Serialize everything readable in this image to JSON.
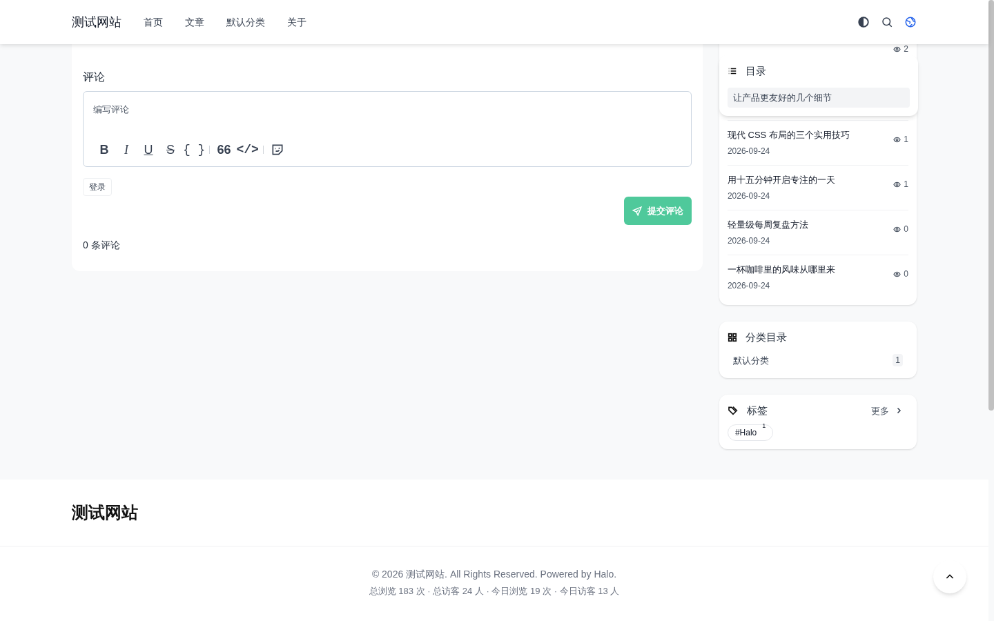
{
  "header": {
    "site_title": "测试网站",
    "nav": [
      {
        "label": "首页"
      },
      {
        "label": "文章"
      },
      {
        "label": "默认分类"
      },
      {
        "label": "关于"
      }
    ]
  },
  "comments": {
    "title": "评论",
    "placeholder": "编写评论",
    "toolbar": [
      {
        "kind": "bold",
        "label": "B"
      },
      {
        "kind": "italic",
        "label": "I"
      },
      {
        "kind": "underline",
        "label": "U"
      },
      {
        "kind": "strike",
        "label": "S"
      },
      {
        "kind": "braces",
        "label": "{ }"
      },
      {
        "kind": "divider"
      },
      {
        "kind": "quote",
        "label": "66"
      },
      {
        "kind": "code",
        "label": "</>"
      },
      {
        "kind": "divider"
      },
      {
        "kind": "sticker"
      }
    ],
    "login": "登录",
    "submit": "提交评论",
    "count": "0 条评论"
  },
  "posts": [
    {
      "views": "2"
    },
    {
      "title": "现代 CSS 布局的三个实用技巧",
      "date": "2026-09-24",
      "views": "1"
    },
    {
      "title": "用十五分钟开启专注的一天",
      "date": "2026-09-24",
      "views": "1"
    },
    {
      "title": "轻量级每周复盘方法",
      "date": "2026-09-24",
      "views": "0"
    },
    {
      "title": "一杯咖啡里的风味从哪里来",
      "date": "2026-09-24",
      "views": "0"
    }
  ],
  "toc": {
    "title": "目录",
    "items": [
      {
        "label": "让产品更友好的几个细节",
        "selected": true
      }
    ]
  },
  "categories": {
    "title": "分类目录",
    "items": [
      {
        "name": "默认分类",
        "count": "1"
      }
    ]
  },
  "tags": {
    "title": "标签",
    "more": "更多",
    "items": [
      {
        "name": "#Halo",
        "count": "1"
      }
    ]
  },
  "footer": {
    "site_title": "测试网站",
    "copyright": "© 2026 测试网站. All Rights Reserved. Powered by Halo.",
    "stats": "总浏览 183 次 · 总访客 24 人 · 今日浏览 19 次 · 今日访客 13 人"
  }
}
